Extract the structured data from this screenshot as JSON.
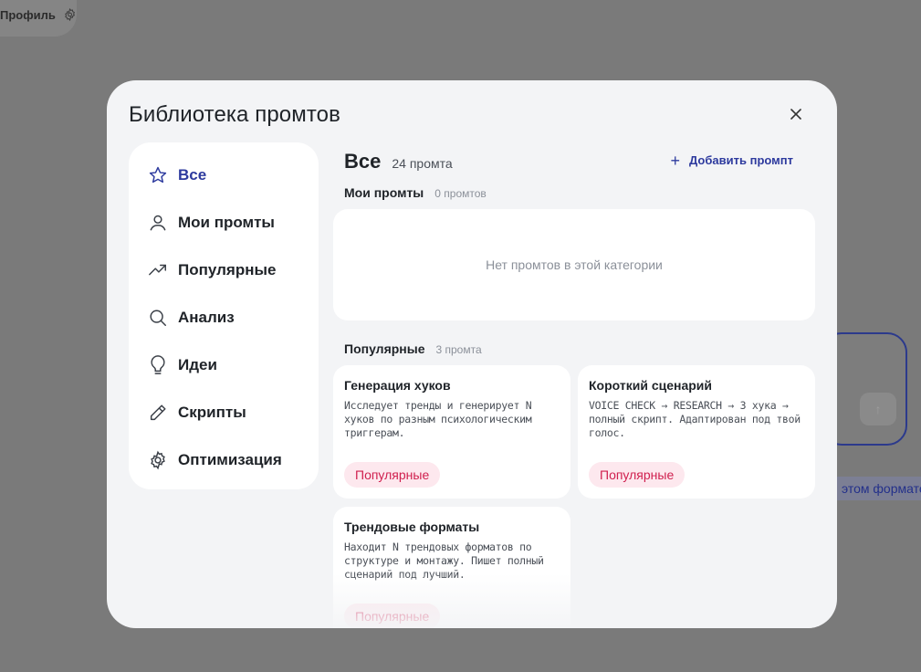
{
  "background": {
    "profile_label": "Профиль",
    "chip_text": "этом формате"
  },
  "modal": {
    "title": "Библиотека промтов"
  },
  "sidebar": {
    "items": [
      {
        "label": "Все",
        "icon": "star-icon",
        "active": true
      },
      {
        "label": "Мои промты",
        "icon": "user-icon"
      },
      {
        "label": "Популярные",
        "icon": "trending-up-icon"
      },
      {
        "label": "Анализ",
        "icon": "search-icon"
      },
      {
        "label": "Идеи",
        "icon": "lightbulb-icon"
      },
      {
        "label": "Скрипты",
        "icon": "pencil-icon"
      },
      {
        "label": "Оптимизация",
        "icon": "gear-icon"
      }
    ]
  },
  "content": {
    "title": "Все",
    "count": "24 промта",
    "add_label": "Добавить промпт",
    "sections": [
      {
        "title": "Мои промты",
        "count": "0 промтов",
        "empty_text": "Нет промтов в этой категории"
      },
      {
        "title": "Популярные",
        "count": "3 промта"
      }
    ],
    "cards": [
      {
        "title": "Генерация хуков",
        "description": "Исследует тренды и генерирует N хуков по разным психологическим триггерам.",
        "badge": "Популярные"
      },
      {
        "title": "Короткий сценарий",
        "description": "VOICE CHECK → RESEARCH → 3 хука → полный скрипт. Адаптирован под твой голос.",
        "badge": "Популярные"
      },
      {
        "title": "Трендовые форматы",
        "description": "Находит N трендовых форматов по структуре и монтажу. Пишет полный сценарий под лучший.",
        "badge": "Популярные"
      }
    ]
  },
  "colors": {
    "accent": "#2d3a9e",
    "badge_bg": "#fde8ee",
    "badge_text": "#d0204f",
    "overlay": "#7a7a7a"
  }
}
